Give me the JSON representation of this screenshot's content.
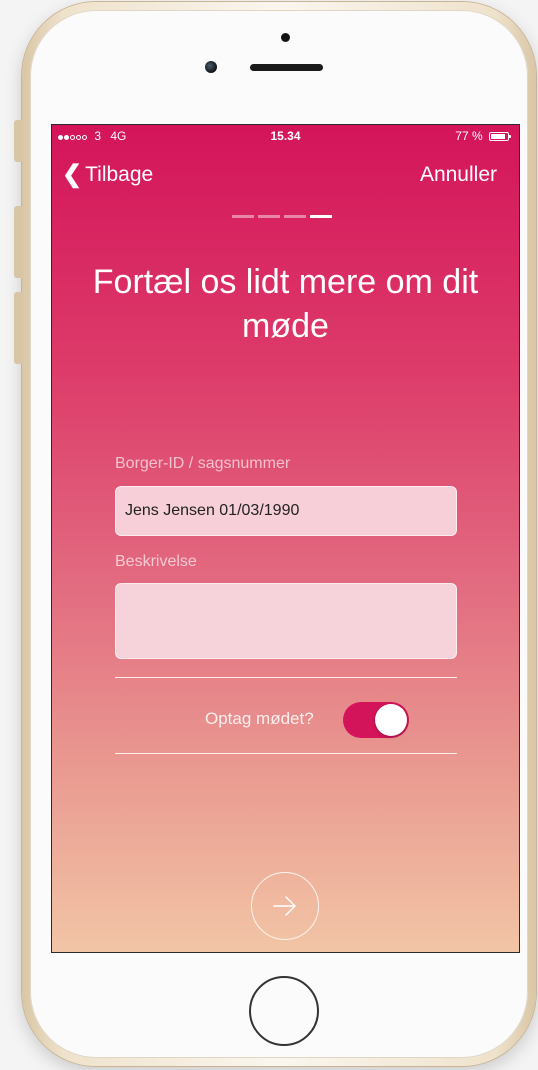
{
  "status_bar": {
    "carrier": "3",
    "network": "4G",
    "time": "15.34",
    "battery": "77 %",
    "signal_dots_filled": 2,
    "signal_dots_total": 5
  },
  "nav": {
    "back_label": "Tilbage",
    "cancel_label": "Annuller"
  },
  "progress": {
    "steps_total": 4,
    "current_step": 4
  },
  "title": "Fortæl os lidt mere om dit møde",
  "form": {
    "id_label": "Borger-ID / sagsnummer",
    "id_value": "Jens Jensen 01/03/1990",
    "description_label": "Beskrivelse",
    "description_value": ""
  },
  "record": {
    "label": "Optag mødet?",
    "enabled": true
  },
  "icons": {
    "back": "chevron-left-icon",
    "next": "arrow-right-icon"
  },
  "colors": {
    "accent": "#d4145a",
    "gradient_top": "#d4145a",
    "gradient_bottom": "#f2c5a6"
  }
}
